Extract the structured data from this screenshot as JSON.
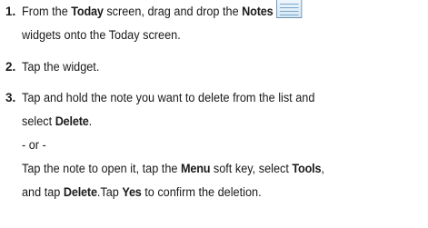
{
  "steps": [
    {
      "number": "1.",
      "line1": {
        "t1": "From the ",
        "b1": "Today",
        "t2": " screen, drag and drop the ",
        "b2": "Notes"
      },
      "line2": "widgets onto the Today screen.",
      "icon": "notes-widget-icon"
    },
    {
      "number": "2.",
      "text": "Tap the widget."
    },
    {
      "number": "3.",
      "line1": "Tap and hold the note you want to delete from the list and",
      "line2": {
        "t1": "select ",
        "b1": "Delete",
        "t2": "."
      },
      "or": "- or -",
      "line4": {
        "t1": "Tap the note to open it, tap the ",
        "b1": "Menu",
        "t2": " soft key, select ",
        "b2": "Tools",
        "t3": ","
      },
      "line5": {
        "t1": "and tap ",
        "b1": "Delete",
        "t2": ".Tap ",
        "b2": "Yes",
        "t3": " to confirm the deletion."
      }
    }
  ]
}
